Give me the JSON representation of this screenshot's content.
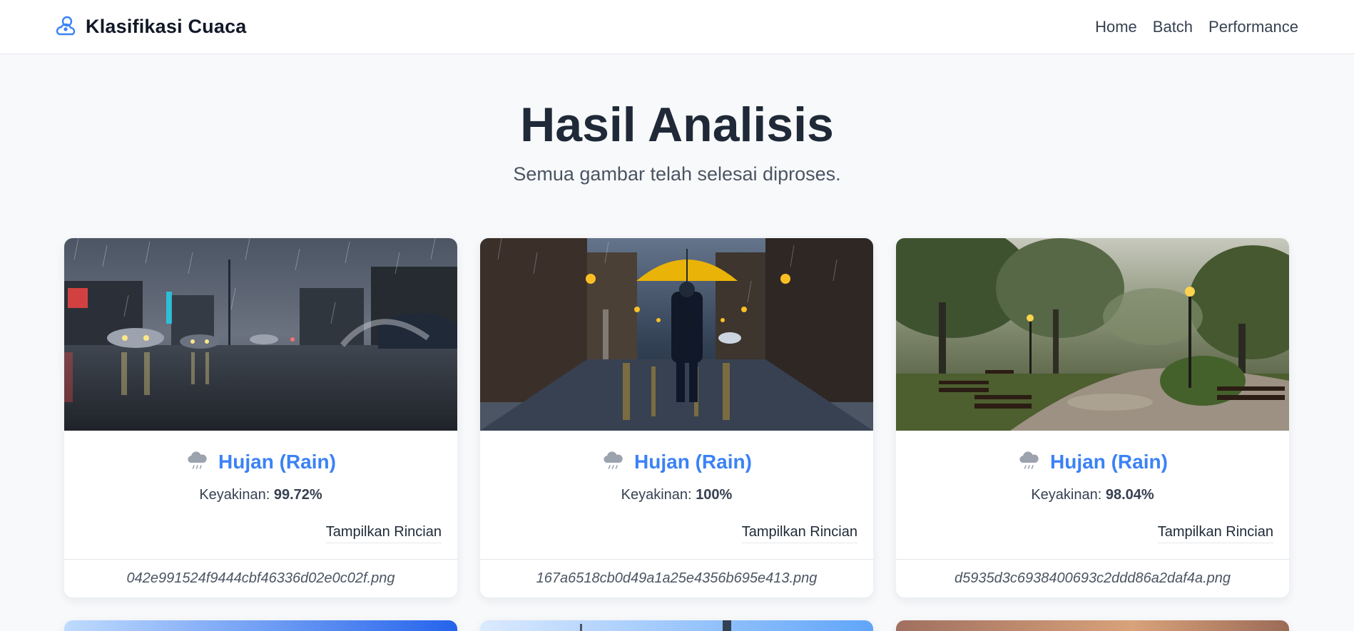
{
  "brand": {
    "title": "Klasifikasi Cuaca",
    "icon": "weather-logo-icon",
    "accent": "#3b82f6"
  },
  "nav": {
    "items": [
      {
        "label": "Home"
      },
      {
        "label": "Batch"
      },
      {
        "label": "Performance"
      }
    ]
  },
  "hero": {
    "title": "Hasil Analisis",
    "subtitle": "Semua gambar telah selesai diproses."
  },
  "results": [
    {
      "label": "Hujan (Rain)",
      "confidence_label": "Keyakinan:",
      "confidence": "99.72%",
      "details_label": "Tampilkan Rincian",
      "filename": "042e991524f9444cbf46336d02e0c02f.png",
      "icon": "rain-cloud-icon"
    },
    {
      "label": "Hujan (Rain)",
      "confidence_label": "Keyakinan:",
      "confidence": "100%",
      "details_label": "Tampilkan Rincian",
      "filename": "167a6518cb0d49a1a25e4356b695e413.png",
      "icon": "rain-cloud-icon"
    },
    {
      "label": "Hujan (Rain)",
      "confidence_label": "Keyakinan:",
      "confidence": "98.04%",
      "details_label": "Tampilkan Rincian",
      "filename": "d5935d3c6938400693c2ddd86a2daf4a.png",
      "icon": "rain-cloud-icon"
    }
  ]
}
